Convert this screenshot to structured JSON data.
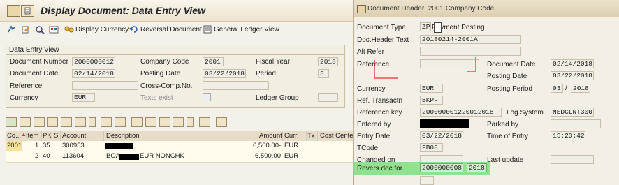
{
  "main": {
    "title": "Display Document: Data Entry View",
    "toolbar": {
      "display_currency": "Display Currency",
      "reversal_document": "Reversal Document",
      "general_ledger_view": "General Ledger View"
    },
    "data_entry_view": {
      "group_title": "Data Entry View",
      "document_number_label": "Document Number",
      "document_number": "2000000012",
      "company_code_label": "Company Code",
      "company_code": "2001",
      "fiscal_year_label": "Fiscal Year",
      "fiscal_year": "2018",
      "document_date_label": "Document Date",
      "document_date": "02/14/2018",
      "posting_date_label": "Posting Date",
      "posting_date": "03/22/2018",
      "period_label": "Period",
      "period": "3",
      "reference_label": "Reference",
      "reference": "",
      "cross_comp_label": "Cross-Comp.No.",
      "cross_comp": "",
      "currency_label": "Currency",
      "currency": "EUR",
      "texts_exist_label": "Texts exist",
      "ledger_group_label": "Ledger Group",
      "ledger_group": ""
    },
    "grid": {
      "columns": [
        "Co...",
        "Item",
        "PK",
        "S",
        "Account",
        "Description",
        "Amount",
        "Curr.",
        "Tx",
        "Cost Center"
      ],
      "rows": [
        {
          "co": "2001",
          "item": "1",
          "pk": "35",
          "s": "",
          "account": "300953",
          "description": "",
          "amount": "6,500.00-",
          "curr": "EUR",
          "tx": "",
          "cost_center": ""
        },
        {
          "co": "",
          "item": "2",
          "pk": "40",
          "s": "",
          "account": "113604",
          "description_prefix": "BOA",
          "description_suffix": "EUR NONCHK",
          "amount": "6,500.00",
          "curr": "EUR",
          "tx": "",
          "cost_center": ""
        }
      ]
    }
  },
  "popup": {
    "title": "Document Header: 2001 Company Code",
    "document_type_label": "Document Type",
    "document_type": "ZP",
    "document_type_text": "Payment Posting",
    "doc_header_text_label": "Doc.Header Text",
    "doc_header_text": "20180214-2001A",
    "alt_refer_label": "Alt Refer",
    "alt_refer": "",
    "reference_label": "Reference",
    "reference": "",
    "document_date_label": "Document Date",
    "document_date": "02/14/2018",
    "posting_date_label": "Posting Date",
    "posting_date": "03/22/2018",
    "currency_label": "Currency",
    "currency": "EUR",
    "posting_period_label": "Posting Period",
    "posting_period": "03",
    "posting_year": "2018",
    "ref_transactn_label": "Ref. Transactn",
    "ref_transactn": "BKPF",
    "reference_key_label": "Reference key",
    "reference_key": "200000001220012018",
    "log_system_label": "Log.System",
    "log_system": "NEDCLNT300",
    "entered_by_label": "Entered by",
    "parked_by_label": "Parked by",
    "parked_by": "",
    "entry_date_label": "Entry Date",
    "entry_date": "03/22/2018",
    "time_of_entry_label": "Time of Entry",
    "time_of_entry": "15:23:42",
    "tcode_label": "TCode",
    "tcode": "FB08",
    "changed_on_label": "Changed on",
    "changed_on": "",
    "last_update_label": "Last update",
    "last_update": "",
    "revers_doc_label": "Revers.doc.for",
    "revers_doc": "2000000008",
    "revers_year": "2018",
    "colors": {
      "highlight": "#7ee07e",
      "annotation": "#e03030"
    }
  }
}
